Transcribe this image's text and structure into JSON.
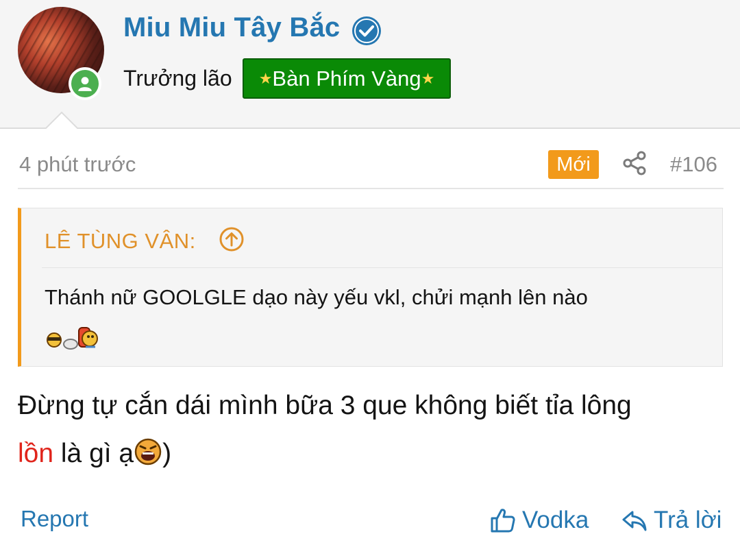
{
  "user": {
    "name": "Miu Miu Tây Bắc",
    "title": "Trưởng lão",
    "banner": "Bàn Phím Vàng",
    "banner_star": "★",
    "verified": true,
    "online": true
  },
  "post": {
    "time": "4 phút trước",
    "badge": "Mới",
    "number": "#106",
    "quote": {
      "author": "LÊ TÙNG VÂN:",
      "text": "Thánh nữ GOOLGLE dạo này yếu vkl, chửi mạnh lên nào"
    },
    "body": {
      "line1": "Đừng tự cắn dái mình bữa 3 que không biết tỉa lông",
      "line2_red": "lồn",
      "line2_rest": " là gì ạ",
      "line2_end": ")"
    }
  },
  "actions": {
    "report": "Report",
    "like": "Vodka",
    "reply": "Trả lời"
  },
  "colors": {
    "link": "#2577b1",
    "accent": "#f29a1b",
    "banner_bg": "#0a8a06",
    "online": "#4caf50",
    "censored": "#e0241b"
  }
}
